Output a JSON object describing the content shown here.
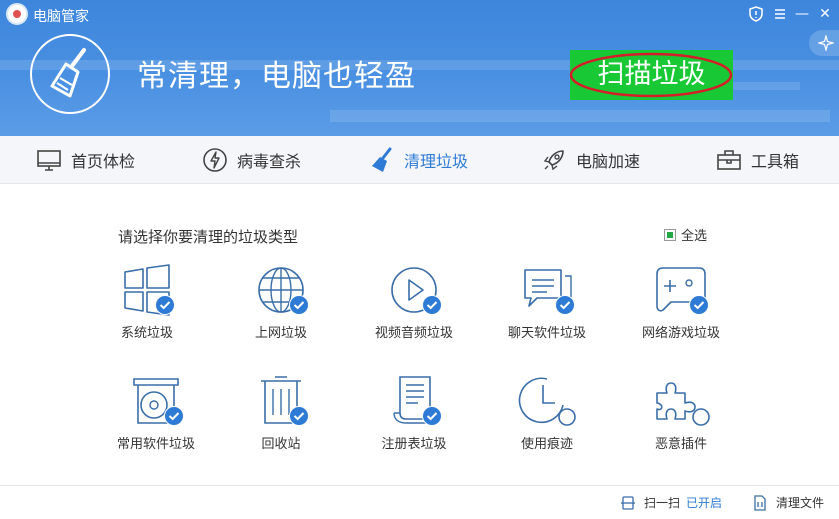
{
  "window": {
    "title": "电脑管家",
    "controls": {
      "shield": "shield-icon",
      "minimize": "—",
      "close": "✕"
    }
  },
  "header": {
    "slogan": "常清理，电脑也轻盈",
    "scan_button": "扫描垃圾",
    "colors": {
      "bg": "#4a90e2",
      "scan": "#18c935",
      "ellipse": "#d21f2a"
    }
  },
  "nav": {
    "items": [
      {
        "label": "首页体检",
        "icon": "monitor-icon"
      },
      {
        "label": "病毒查杀",
        "icon": "lightning-icon"
      },
      {
        "label": "清理垃圾",
        "icon": "broom-icon",
        "active": true
      },
      {
        "label": "电脑加速",
        "icon": "rocket-icon"
      },
      {
        "label": "工具箱",
        "icon": "toolbox-icon"
      }
    ]
  },
  "content": {
    "prompt": "请选择你要清理的垃圾类型",
    "select_all": "全选",
    "items": [
      {
        "label": "系统垃圾",
        "icon": "windows-icon",
        "checked": true
      },
      {
        "label": "上网垃圾",
        "icon": "globe-icon",
        "checked": true
      },
      {
        "label": "视频音频垃圾",
        "icon": "play-icon",
        "checked": true
      },
      {
        "label": "聊天软件垃圾",
        "icon": "chat-icon",
        "checked": true
      },
      {
        "label": "网络游戏垃圾",
        "icon": "gamepad-icon",
        "checked": true
      },
      {
        "label": "常用软件垃圾",
        "icon": "disc-icon",
        "checked": true
      },
      {
        "label": "回收站",
        "icon": "trash-icon",
        "checked": true
      },
      {
        "label": "注册表垃圾",
        "icon": "registry-icon",
        "checked": true
      },
      {
        "label": "使用痕迹",
        "icon": "clock-icon",
        "checked": false
      },
      {
        "label": "恶意插件",
        "icon": "puzzle-icon",
        "checked": false
      }
    ]
  },
  "footer": {
    "scan": {
      "label": "扫一扫",
      "status": "已开启"
    },
    "shred": {
      "label": "清理文件"
    }
  }
}
